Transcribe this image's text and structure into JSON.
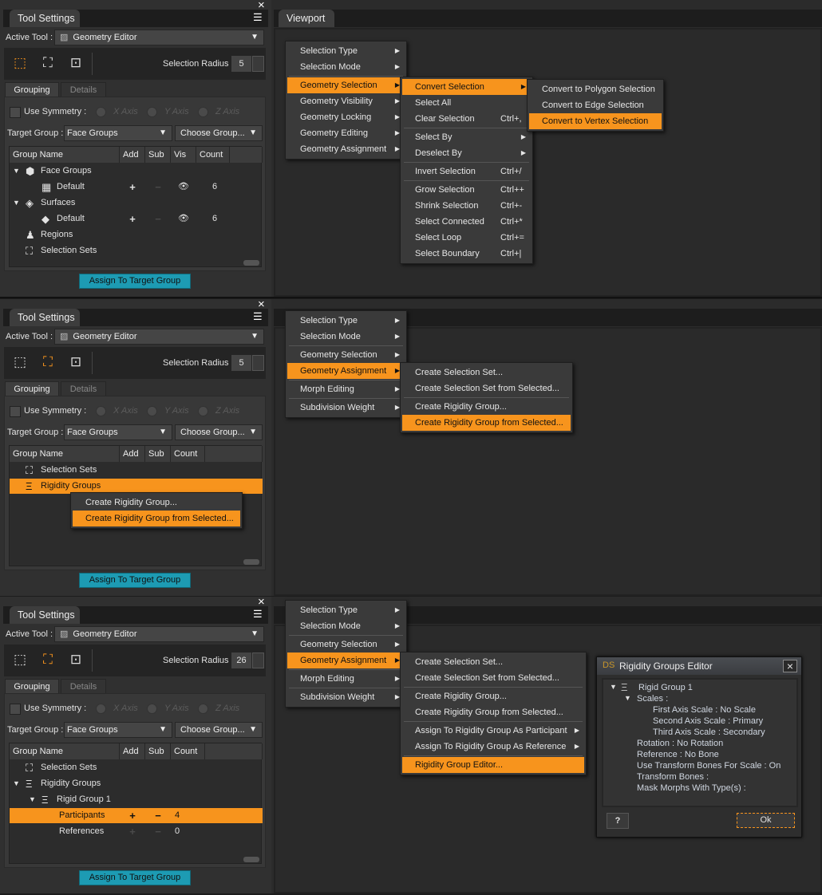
{
  "colors": {
    "accent": "#f7941d",
    "assign_button": "#1d9bb3",
    "panel": "#303030",
    "menu": "#3a3a3a"
  },
  "sections": [
    {
      "tool_settings": {
        "tab_title": "Tool Settings",
        "close_icon": "×",
        "menu_icon": "panel-menu",
        "active_tool_label": "Active Tool :",
        "active_tool_value": "Geometry Editor",
        "active_select_tool": "drag-select",
        "selection_radius_label": "Selection Radius :",
        "selection_radius_value": "5",
        "tabs": [
          "Grouping",
          "Details"
        ],
        "active_tab": "Grouping",
        "use_symmetry_label": "Use Symmetry :",
        "use_symmetry_checked": false,
        "axes": [
          "X Axis",
          "Y Axis",
          "Z Axis"
        ],
        "target_group_label": "Target Group :",
        "target_group_value": "Face Groups",
        "choose_group_label": "Choose Group...",
        "columns": [
          "Group Name",
          "Add",
          "Sub",
          "Vis",
          "Count"
        ],
        "rows": [
          {
            "label": "Face Groups",
            "icon": "face-groups-icon",
            "expanded": true,
            "indent": 0
          },
          {
            "label": "Default",
            "icon": "face-group-icon",
            "indent": 1,
            "add": "+",
            "sub": "−",
            "vis": "eye",
            "count": "6"
          },
          {
            "label": "Surfaces",
            "icon": "surfaces-icon",
            "expanded": true,
            "indent": 0
          },
          {
            "label": "Default",
            "icon": "surface-icon",
            "indent": 1,
            "add": "+",
            "sub": "−",
            "vis": "eye",
            "count": "6"
          },
          {
            "label": "Regions",
            "icon": "regions-icon",
            "indent": 0
          },
          {
            "label": "Selection Sets",
            "icon": "selection-sets-icon",
            "indent": 0
          }
        ],
        "assign_button": "Assign To Target Group"
      },
      "viewport": {
        "tab_title": "Viewport",
        "menus": [
          {
            "items": [
              {
                "label": "Selection Type",
                "submenu": true
              },
              {
                "label": "Selection Mode",
                "submenu": true
              },
              {
                "sep": true
              },
              {
                "label": "Geometry Selection",
                "submenu": true,
                "highlighted": true
              },
              {
                "label": "Geometry Visibility",
                "submenu": true
              },
              {
                "label": "Geometry Locking",
                "submenu": true
              },
              {
                "label": "Geometry Editing",
                "submenu": true
              },
              {
                "label": "Geometry Assignment",
                "submenu": true
              }
            ]
          },
          {
            "items": [
              {
                "label": "Convert Selection",
                "submenu": true,
                "highlighted": true
              },
              {
                "label": "Select All"
              },
              {
                "label": "Clear Selection",
                "shortcut": "Ctrl+,"
              },
              {
                "sep": true
              },
              {
                "label": "Select By",
                "submenu": true
              },
              {
                "label": "Deselect By",
                "submenu": true
              },
              {
                "sep": true
              },
              {
                "label": "Invert Selection",
                "shortcut": "Ctrl+/"
              },
              {
                "sep": true
              },
              {
                "label": "Grow Selection",
                "shortcut": "Ctrl++"
              },
              {
                "label": "Shrink Selection",
                "shortcut": "Ctrl+-"
              },
              {
                "label": "Select Connected",
                "shortcut": "Ctrl+*"
              },
              {
                "label": "Select Loop",
                "shortcut": "Ctrl+="
              },
              {
                "label": "Select Boundary",
                "shortcut": "Ctrl+|"
              }
            ]
          },
          {
            "items": [
              {
                "label": "Convert to Polygon Selection"
              },
              {
                "label": "Convert to Edge Selection"
              },
              {
                "label": "Convert to Vertex Selection",
                "highlighted": true
              }
            ]
          }
        ]
      }
    },
    {
      "tool_settings": {
        "tab_title": "Tool Settings",
        "close_icon": "×",
        "menu_icon": "panel-menu",
        "active_tool_label": "Active Tool :",
        "active_tool_value": "Geometry Editor",
        "active_select_tool": "lasso-select",
        "selection_radius_label": "Selection Radius :",
        "selection_radius_value": "5",
        "tabs": [
          "Grouping",
          "Details"
        ],
        "active_tab": "Grouping",
        "use_symmetry_label": "Use Symmetry :",
        "use_symmetry_checked": false,
        "axes": [
          "X Axis",
          "Y Axis",
          "Z Axis"
        ],
        "target_group_label": "Target Group :",
        "target_group_value": "Face Groups",
        "choose_group_label": "Choose Group...",
        "columns": [
          "Group Name",
          "Add",
          "Sub",
          "Count"
        ],
        "rows": [
          {
            "label": "Selection Sets",
            "icon": "selection-sets-icon",
            "indent": 0
          },
          {
            "label": "Rigidity Groups",
            "icon": "rigidity-groups-icon",
            "indent": 0,
            "highlighted": true
          }
        ],
        "context_menu": {
          "items": [
            {
              "label": "Create Rigidity Group..."
            },
            {
              "label": "Create Rigidity Group from Selected...",
              "highlighted": true
            }
          ]
        },
        "assign_button": "Assign To Target Group"
      },
      "viewport": {
        "menus": [
          {
            "items": [
              {
                "label": "Selection Type",
                "submenu": true
              },
              {
                "label": "Selection Mode",
                "submenu": true
              },
              {
                "sep": true
              },
              {
                "label": "Geometry Selection",
                "submenu": true
              },
              {
                "label": "Geometry Assignment",
                "submenu": true,
                "highlighted": true
              },
              {
                "sep": true
              },
              {
                "label": "Morph Editing",
                "submenu": true
              },
              {
                "sep": true
              },
              {
                "label": "Subdivision Weight",
                "submenu": true
              }
            ]
          },
          {
            "items": [
              {
                "label": "Create Selection Set..."
              },
              {
                "label": "Create Selection Set from Selected..."
              },
              {
                "sep": true
              },
              {
                "label": "Create Rigidity Group..."
              },
              {
                "label": "Create Rigidity Group from Selected...",
                "highlighted": true
              }
            ]
          }
        ]
      }
    },
    {
      "tool_settings": {
        "tab_title": "Tool Settings",
        "close_icon": "×",
        "menu_icon": "panel-menu",
        "active_tool_label": "Active Tool :",
        "active_tool_value": "Geometry Editor",
        "active_select_tool": "lasso-select",
        "selection_radius_label": "Selection Radius :",
        "selection_radius_value": "26",
        "tabs": [
          "Grouping",
          "Details"
        ],
        "active_tab": "Grouping",
        "use_symmetry_label": "Use Symmetry :",
        "use_symmetry_checked": false,
        "axes": [
          "X Axis",
          "Y Axis",
          "Z Axis"
        ],
        "target_group_label": "Target Group :",
        "target_group_value": "Face Groups",
        "choose_group_label": "Choose Group...",
        "columns": [
          "Group Name",
          "Add",
          "Sub",
          "Count"
        ],
        "rows": [
          {
            "label": "Selection Sets",
            "icon": "selection-sets-icon",
            "indent": 0
          },
          {
            "label": "Rigidity Groups",
            "icon": "rigidity-groups-icon",
            "indent": 0,
            "expanded": true
          },
          {
            "label": "Rigid Group 1",
            "icon": "rigid-group-icon",
            "indent": 1,
            "expanded": true
          },
          {
            "label": "Participants",
            "indent": 2,
            "add": "+",
            "sub": "−",
            "count": "4",
            "highlighted": true
          },
          {
            "label": "References",
            "indent": 2,
            "add": "+",
            "sub": "−",
            "count": "0",
            "disabled_actions": true
          }
        ],
        "assign_button": "Assign To Target Group"
      },
      "viewport": {
        "menus": [
          {
            "items": [
              {
                "label": "Selection Type",
                "submenu": true
              },
              {
                "label": "Selection Mode",
                "submenu": true
              },
              {
                "sep": true
              },
              {
                "label": "Geometry Selection",
                "submenu": true
              },
              {
                "label": "Geometry Assignment",
                "submenu": true,
                "highlighted": true
              },
              {
                "sep": true
              },
              {
                "label": "Morph Editing",
                "submenu": true
              },
              {
                "sep": true
              },
              {
                "label": "Subdivision Weight",
                "submenu": true
              }
            ]
          },
          {
            "items": [
              {
                "label": "Create Selection Set..."
              },
              {
                "label": "Create Selection Set from Selected..."
              },
              {
                "sep": true
              },
              {
                "label": "Create Rigidity Group..."
              },
              {
                "label": "Create Rigidity Group from Selected..."
              },
              {
                "sep": true
              },
              {
                "label": "Assign To Rigidity Group As Participant",
                "submenu": true
              },
              {
                "label": "Assign To Rigidity Group As Reference",
                "submenu": true
              },
              {
                "sep": true
              },
              {
                "label": "Rigidity Group Editor...",
                "highlighted": true
              }
            ]
          }
        ],
        "dialog": {
          "logo": "DS",
          "title": "Rigidity Groups Editor",
          "close_icon": "×",
          "tree": [
            {
              "label": "Rigid Group 1",
              "level": 0,
              "expander": true,
              "icon": true
            },
            {
              "label": "Scales :",
              "level": 1,
              "expander": true
            },
            {
              "label": "First Axis Scale : No Scale",
              "level": 2
            },
            {
              "label": "Second Axis Scale : Primary",
              "level": 2
            },
            {
              "label": "Third Axis Scale : Secondary",
              "level": 2
            },
            {
              "label": "Rotation : No Rotation",
              "level": 1
            },
            {
              "label": "Reference : No Bone",
              "level": 1
            },
            {
              "label": "Use Transform Bones For Scale : On",
              "level": 1
            },
            {
              "label": "Transform Bones :",
              "level": 1
            },
            {
              "label": "Mask Morphs With Type(s) :",
              "level": 1
            }
          ],
          "help_icon": "?",
          "ok_label": "Ok"
        }
      }
    }
  ]
}
